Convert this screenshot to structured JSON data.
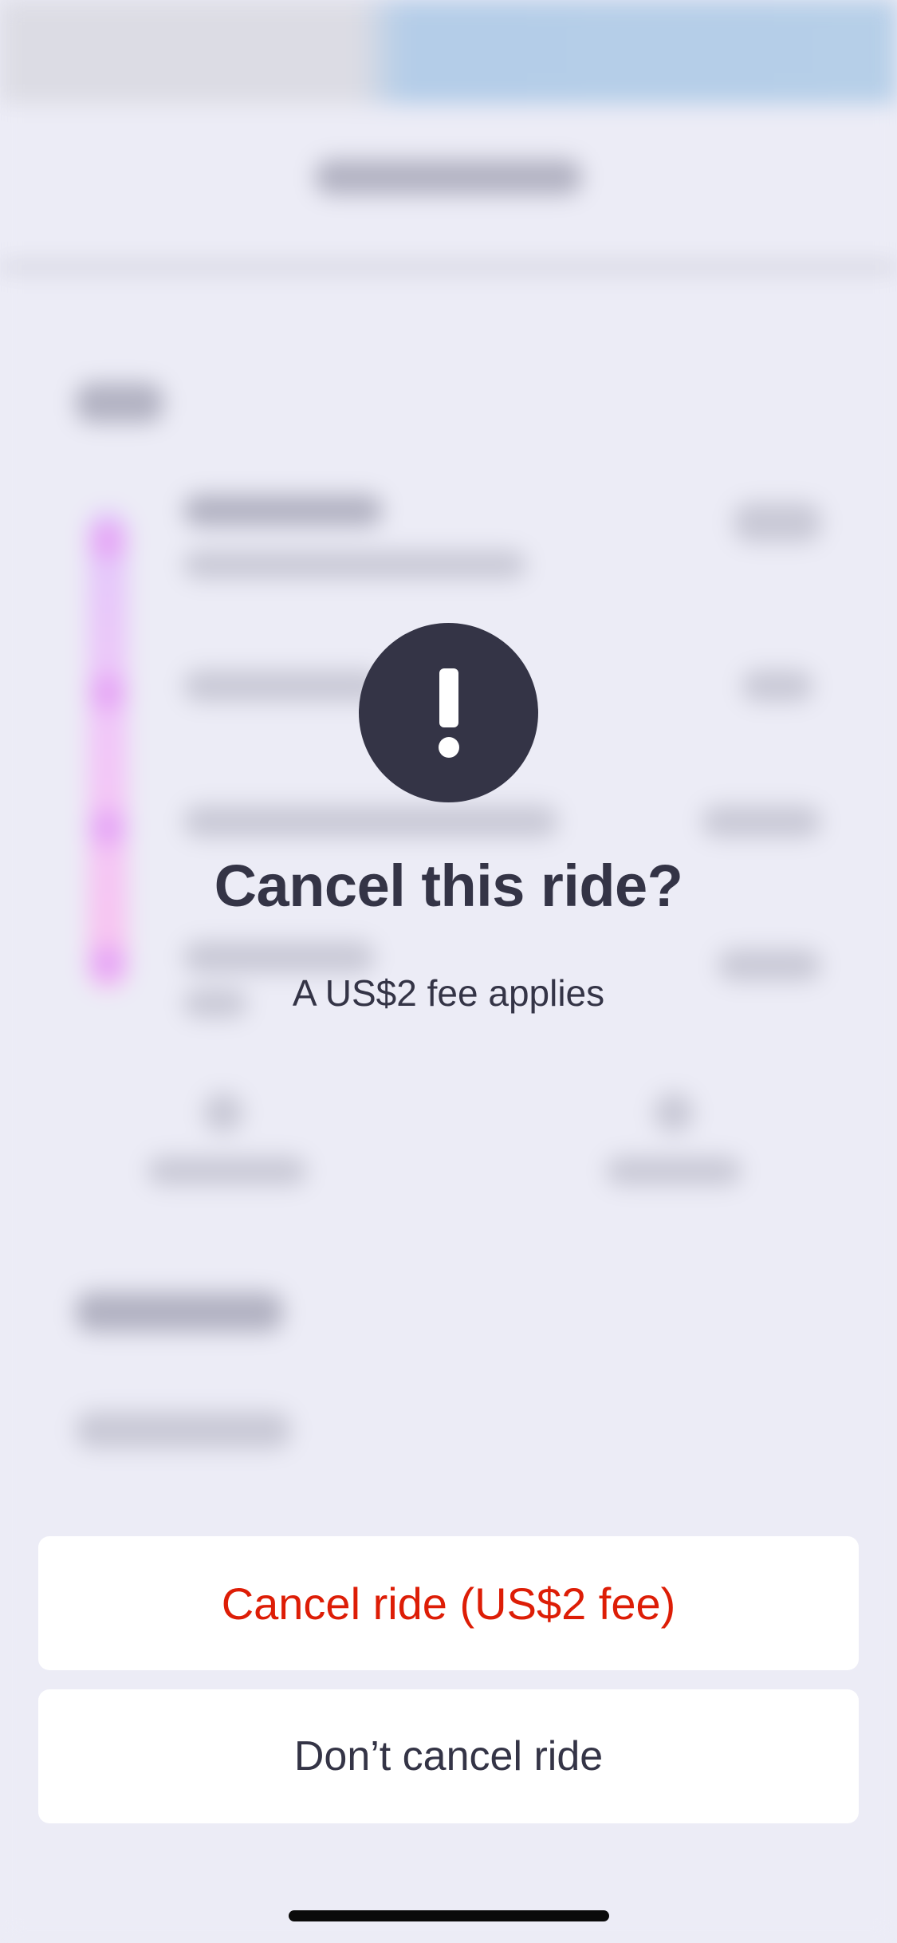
{
  "dialog": {
    "icon": "exclamation-icon",
    "title": "Cancel this ride?",
    "subtitle": "A US$2 fee applies"
  },
  "actions": {
    "confirm_label": "Cancel ride (US$2 fee)",
    "dismiss_label": "Don’t cancel ride"
  },
  "colors": {
    "dark": "#343446",
    "danger": "#dd1d06",
    "overlay": "#ececf6"
  }
}
